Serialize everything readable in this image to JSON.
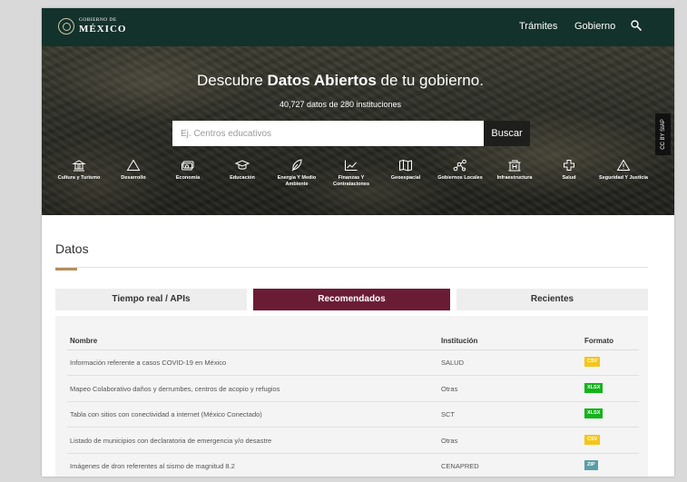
{
  "navbar": {
    "logo_line1": "GOBIERNO DE",
    "logo_line2": "MÉXICO",
    "links": [
      "Trámites",
      "Gobierno"
    ],
    "search_icon": "search-icon"
  },
  "hero": {
    "title_pre": "Descubre ",
    "title_bold": "Datos Abiertos",
    "title_post": " de tu gobierno.",
    "subtitle": "40,727 datos de 280 instituciones",
    "search_placeholder": "Ej. Centros educativos",
    "search_button": "Buscar",
    "credit": "CC BY SIAP",
    "categories": [
      {
        "label": "Cultura y Turismo",
        "icon": "monument-icon"
      },
      {
        "label": "Desarrollo",
        "icon": "triangle-icon"
      },
      {
        "label": "Economía",
        "icon": "money-icon"
      },
      {
        "label": "Educación",
        "icon": "graduation-cap-icon"
      },
      {
        "label": "Energía Y Medio Ambiente",
        "icon": "leaf-icon"
      },
      {
        "label": "Finanzas Y Contrataciones",
        "icon": "line-chart-icon"
      },
      {
        "label": "Geoespacial",
        "icon": "map-icon"
      },
      {
        "label": "Gobiernos Locales",
        "icon": "network-icon"
      },
      {
        "label": "Infraestructura",
        "icon": "building-icon"
      },
      {
        "label": "Salud",
        "icon": "medical-cross-icon"
      },
      {
        "label": "Seguridad Y Justicia",
        "icon": "warning-icon"
      }
    ]
  },
  "datos": {
    "title": "Datos",
    "tabs": [
      "Tiempo real / APIs",
      "Recomendados",
      "Recientes"
    ],
    "active_tab": "Recomendados",
    "columns": [
      "Nombre",
      "Institución",
      "Formato"
    ],
    "rows": [
      {
        "name": "Información referente a casos COVID-19 en México",
        "institution": "SALUD",
        "format": "CSV"
      },
      {
        "name": "Mapeo Colaborativo daños y derrumbes, centros de acopio y refugios",
        "institution": "Otras",
        "format": "XLSX"
      },
      {
        "name": "Tabla con sitios con conectividad a internet (México Conectado)",
        "institution": "SCT",
        "format": "XLSX"
      },
      {
        "name": "Listado de municipios con declaratoria de emergencia y/o desastre",
        "institution": "Otras",
        "format": "CSV"
      },
      {
        "name": "Imágenes de dron referentes al sismo de magnitud 8.2",
        "institution": "CENAPRED",
        "format": "ZIP"
      }
    ]
  },
  "colors": {
    "navbar": "#13322b",
    "active_tab": "#6b1c35",
    "accent": "#b38e5d",
    "csv": "#f5c518",
    "xlsx": "#12b41a",
    "zip": "#5a9ea8"
  }
}
